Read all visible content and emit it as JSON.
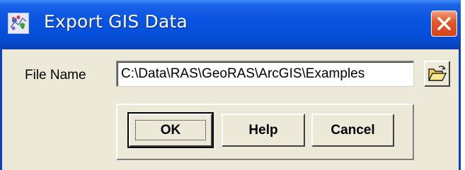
{
  "window": {
    "title": "Export GIS Data",
    "app_icon": "map-app-icon",
    "close_icon": "close-icon"
  },
  "form": {
    "file_name_label": "File Name",
    "file_name_value": "C:\\Data\\RAS\\GeoRAS\\ArcGIS\\Examples",
    "browse_icon": "folder-open-icon"
  },
  "buttons": {
    "ok": "OK",
    "help": "Help",
    "cancel": "Cancel"
  },
  "colors": {
    "titlebar": "#0a55e2",
    "window_face": "#ece9d8",
    "close_button": "#e65a2c"
  }
}
